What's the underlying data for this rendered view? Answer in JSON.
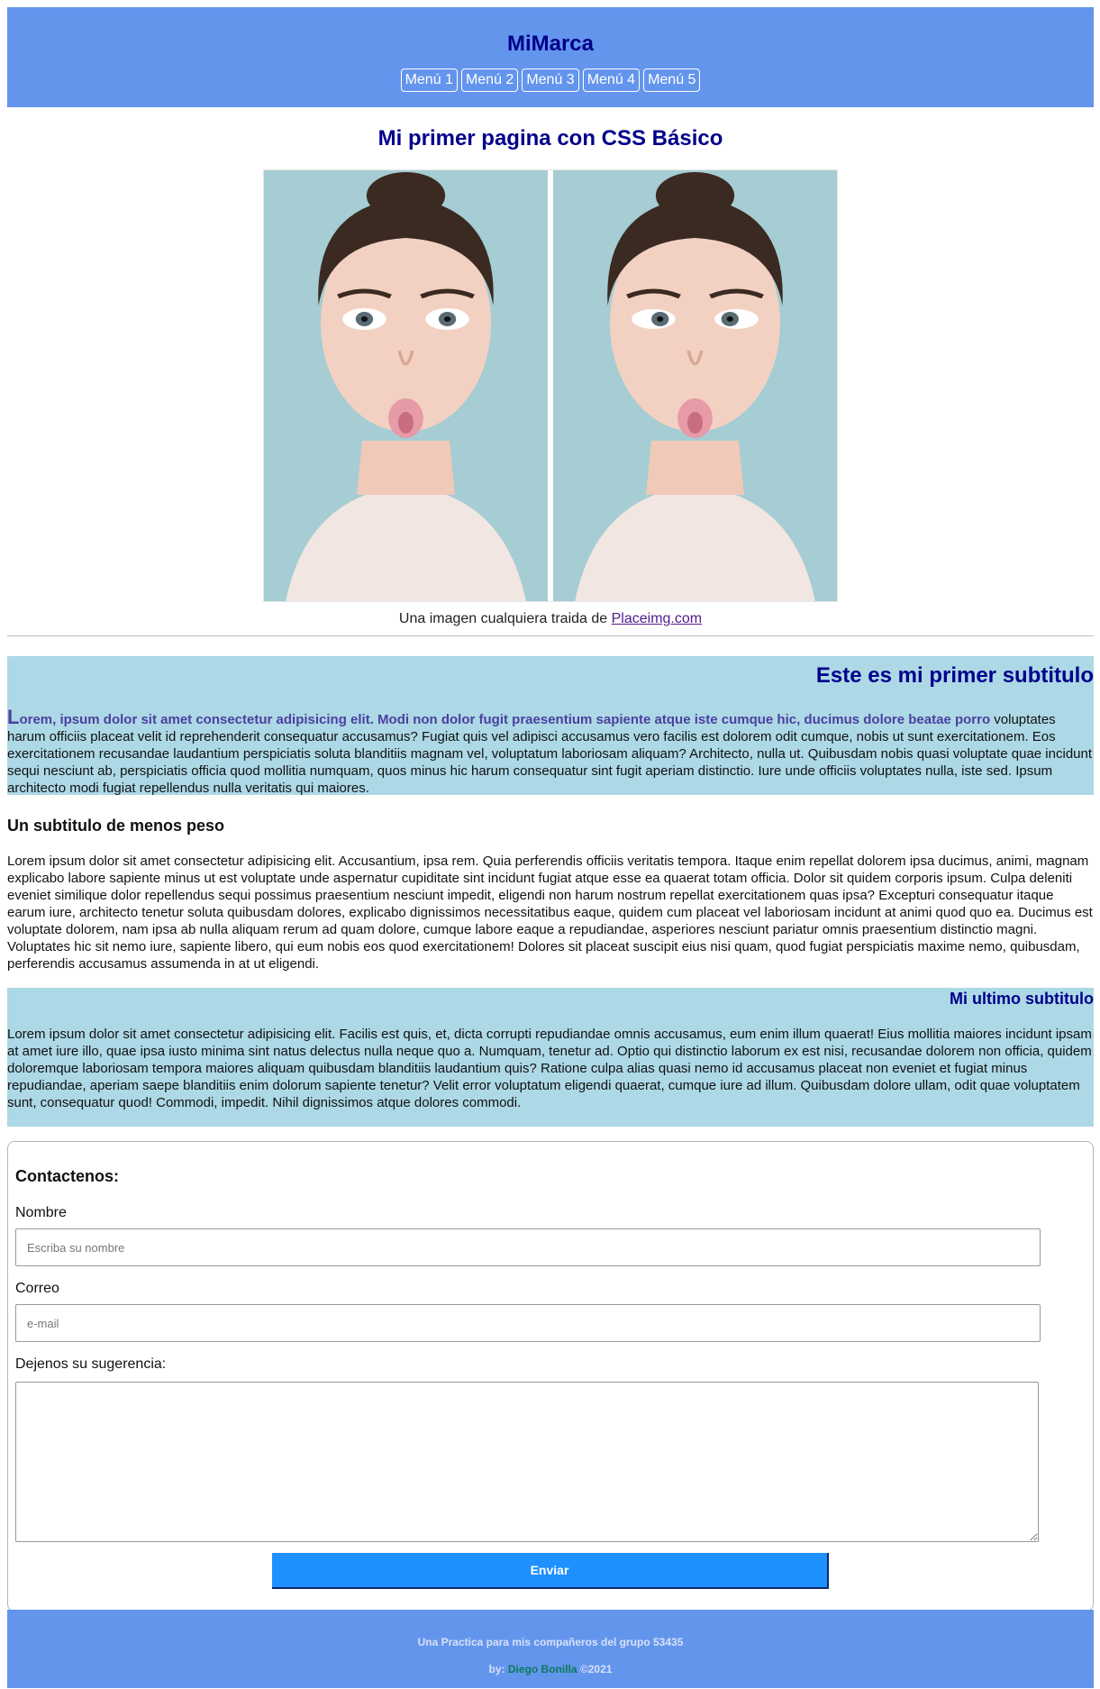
{
  "header": {
    "brand": "MiMarca",
    "menu": [
      "Menú 1",
      "Menú 2",
      "Menú 3",
      "Menú 4",
      "Menú 5"
    ]
  },
  "main": {
    "title": "Mi primer pagina con CSS Básico",
    "caption_prefix": "Una imagen cualquiera traida de ",
    "caption_link": "Placeimg.com"
  },
  "subtitle1": {
    "title": "Este es mi primer subtitulo",
    "drop_letter": "L",
    "first_line": "orem, ipsum dolor sit amet consectetur adipisicing elit. Modi non dolor fugit praesentium sapiente atque iste cumque hic, ducimus dolore beatae porro",
    "rest": " voluptates harum officiis placeat velit id reprehenderit consequatur accusamus? Fugiat quis vel adipisci accusamus vero facilis est dolorem odit cumque, nobis ut sunt exercitationem. Eos exercitationem recusandae laudantium perspiciatis soluta blanditiis magnam vel, voluptatum laboriosam aliquam? Architecto, nulla ut. Quibusdam nobis quasi voluptate quae incidunt sequi nesciunt ab, perspiciatis officia quod mollitia numquam, quos minus hic harum consequatur sint fugit aperiam distinctio. Iure unde officiis voluptates nulla, iste sed. Ipsum architecto modi fugiat repellendus nulla veritatis qui maiores."
  },
  "subtitle2": {
    "title": "Un subtitulo de menos peso",
    "text": "Lorem ipsum dolor sit amet consectetur adipisicing elit. Accusantium, ipsa rem. Quia perferendis officiis veritatis tempora. Itaque enim repellat dolorem ipsa ducimus, animi, magnam explicabo labore sapiente minus ut est voluptate unde aspernatur cupiditate sint incidunt fugiat atque esse ea quaerat totam officia. Dolor sit quidem corporis ipsum. Culpa deleniti eveniet similique dolor repellendus sequi possimus praesentium nesciunt impedit, eligendi non harum nostrum repellat exercitationem quas ipsa? Excepturi consequatur itaque earum iure, architecto tenetur soluta quibusdam dolores, explicabo dignissimos necessitatibus eaque, quidem cum placeat vel laboriosam incidunt at animi quod quo ea. Ducimus est voluptate dolorem, nam ipsa ab nulla aliquam rerum ad quam dolore, cumque labore eaque a repudiandae, asperiores nesciunt pariatur omnis praesentium distinctio magni. Voluptates hic sit nemo iure, sapiente libero, qui eum nobis eos quod exercitationem! Dolores sit placeat suscipit eius nisi quam, quod fugiat perspiciatis maxime nemo, quibusdam, perferendis accusamus assumenda in at ut eligendi."
  },
  "subtitle3": {
    "title": "Mi ultimo subtitulo",
    "text": "Lorem ipsum dolor sit amet consectetur adipisicing elit. Facilis est quis, et, dicta corrupti repudiandae omnis accusamus, eum enim illum quaerat! Eius mollitia maiores incidunt ipsam at amet iure illo, quae ipsa iusto minima sint natus delectus nulla neque quo a. Numquam, tenetur ad. Optio qui distinctio laborum ex est nisi, recusandae dolorem non officia, quidem doloremque laboriosam tempora maiores aliquam quibusdam blanditiis laudantium quis? Ratione culpa alias quasi nemo id accusamus placeat non eveniet et fugiat minus repudiandae, aperiam saepe blanditiis enim dolorum sapiente tenetur? Velit error voluptatum eligendi quaerat, cumque iure ad illum. Quibusdam dolore ullam, odit quae voluptatem sunt, consequatur quod! Commodi, impedit. Nihil dignissimos atque dolores commodi.",
    "text_visible": "Lorem ipsum dolor sit amet consectetur adipisicing elit. Facilis est quis, et, dicta corrupti repudiandae omnis accusamus, eum enim illum quaerat! Eius mollitia maiores incidunt ipsam at amet iure illo, quae ipsa iusto minima sint natus delectus nulla neque quo a. Numquam, tenetur ad. Optio qui distinctio laborum ex est nisi, recusandae dolorem non officia, quidem doloremque laboriosam tempora maiores aliquam quibusdam blanditiis laudantium quis? Ratione culpa alias quasi nemo id accusamus placeat non eveniet et fugiat minus repudiandae, aperiam saepe blanditiis enim dolorum sapiente tenetur? Velit error voluptatum eligendi quaerat, cumque iure ad illum. Quibusdam dolore ullam, odit quae voluptatem sunt, consequatur quod! Commodi, impedit. Nihil dignissimos atque dolores commodi."
  },
  "contact": {
    "title": "Contactenos:",
    "name_label": "Nombre",
    "name_placeholder": "Escriba su nombre",
    "email_label": "Correo",
    "email_placeholder": "e-mail",
    "message_label": "Dejenos su sugerencia:",
    "submit_label": "Enviar"
  },
  "footer": {
    "line1": "Una Practica para mis compañeros del grupo 53435",
    "by": "by: ",
    "author": "Diego Bonilla",
    "year": " ©2021"
  },
  "colors": {
    "header_bg": "#6495ED",
    "section_bg": "#ADD8E6",
    "title_color": "#00008B",
    "button_bg": "#1E90FF"
  }
}
